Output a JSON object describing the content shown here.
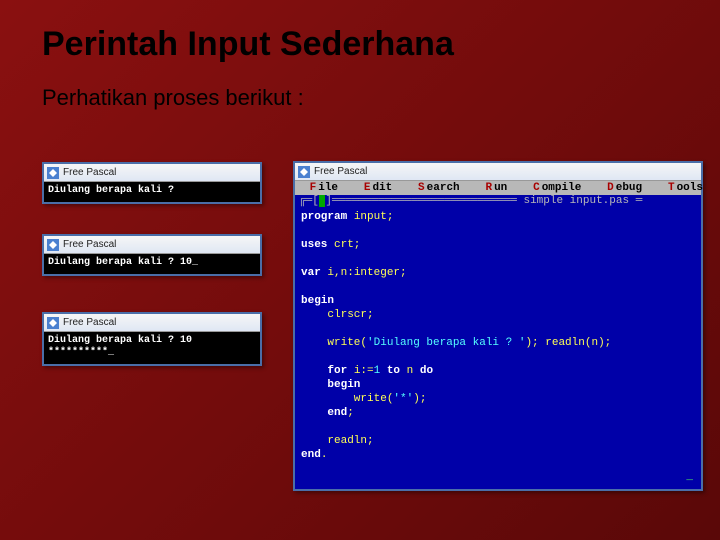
{
  "slide": {
    "title": "Perintah Input Sederhana",
    "subtitle": "Perhatikan proses berikut :"
  },
  "app_title": "Free Pascal",
  "console": {
    "win1_line1": "Diulang berapa kali ? ",
    "win2_line1": "Diulang berapa kali ? 10_",
    "win3_line1": "Diulang berapa kali ? 10",
    "win3_line2": "**********_"
  },
  "ide": {
    "menu": {
      "file": "File",
      "file_hot": "F",
      "edit": "Edit",
      "edit_hot": "E",
      "search": "Search",
      "search_hot": "S",
      "run": "Run",
      "run_hot": "R",
      "compile": "Compile",
      "compile_hot": "C",
      "debug": "Debug",
      "debug_hot": "D",
      "tools": "Tools",
      "tools_hot": "T"
    },
    "filename": "simple input.pas",
    "code": {
      "l1a": "program",
      "l1b": " input;",
      "l2": "",
      "l3a": "uses",
      "l3b": " crt;",
      "l4": "",
      "l5a": "var",
      "l5b": " i,n:integer;",
      "l6": "",
      "l7": "begin",
      "l8": "    clrscr;",
      "l9": "",
      "l10a": "    write(",
      "l10s": "'Diulang berapa kali ? '",
      "l10b": "); readln(n);",
      "l11": "",
      "l12a": "    for",
      "l12b": " i:=",
      "l12n": "1",
      "l12c": " to",
      "l12d": " n ",
      "l12e": "do",
      "l13": "    begin",
      "l14a": "        write(",
      "l14s": "'*'",
      "l14b": ");",
      "l15a": "    end",
      "l15b": ";",
      "l16": "",
      "l17": "    readln;",
      "l18a": "end",
      "l18b": "."
    }
  }
}
